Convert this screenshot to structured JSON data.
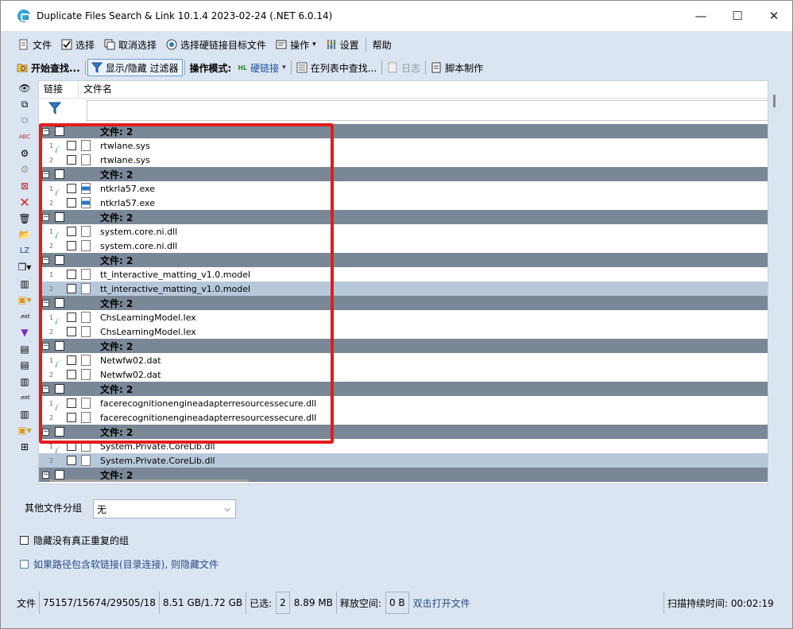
{
  "window": {
    "title": "Duplicate Files Search & Link 10.1.4 2023-02-24 (.NET 6.0.14)",
    "minimize": "—",
    "maximize": "☐",
    "close": "✕"
  },
  "menu": [
    {
      "label": "文件",
      "icon": "file-icon"
    },
    {
      "label": "选择",
      "icon": "select-icon"
    },
    {
      "label": "取消选择",
      "icon": "deselect-icon"
    },
    {
      "label": "选择硬链接目标文件",
      "icon": "hardlink-target-icon"
    },
    {
      "label": "操作",
      "icon": "operations-icon",
      "dropdown": "▾"
    },
    {
      "label": "设置",
      "icon": "settings-icon"
    },
    {
      "label": "帮助",
      "icon": ""
    }
  ],
  "toolbar": {
    "start_search": "开始查找...",
    "show_hide_filter": "显示/隐藏 过滤器",
    "mode_label": "操作模式:",
    "mode_value": "硬链接",
    "mode_badge": "HL",
    "find_in_list": "在列表中查找...",
    "log": "日志",
    "script": "脚本制作"
  },
  "grid": {
    "col_link": "链接",
    "col_filename": "文件名",
    "groups": [
      {
        "title": "文件: 2",
        "files": [
          {
            "index": "1",
            "name": "rtwlane.sys",
            "icon": "sys-file-icon",
            "selected": false
          },
          {
            "index": "2",
            "name": "rtwlane.sys",
            "icon": "sys-file-icon",
            "selected": false
          }
        ]
      },
      {
        "title": "文件: 2",
        "files": [
          {
            "index": "1",
            "name": "ntkrla57.exe",
            "icon": "exe-file-icon",
            "selected": false
          },
          {
            "index": "2",
            "name": "ntkrla57.exe",
            "icon": "exe-file-icon",
            "selected": false
          }
        ]
      },
      {
        "title": "文件: 2",
        "files": [
          {
            "index": "1",
            "name": "system.core.ni.dll",
            "icon": "dll-file-icon",
            "selected": false
          },
          {
            "index": "2",
            "name": "system.core.ni.dll",
            "icon": "dll-file-icon",
            "selected": false
          }
        ]
      },
      {
        "title": "文件: 2",
        "files": [
          {
            "index": "1",
            "name": "tt_interactive_matting_v1.0.model",
            "icon": "file-icon",
            "selected": false
          },
          {
            "index": "2",
            "name": "tt_interactive_matting_v1.0.model",
            "icon": "file-icon",
            "selected": true
          }
        ]
      },
      {
        "title": "文件: 2",
        "files": [
          {
            "index": "1",
            "name": "ChsLearningModel.lex",
            "icon": "file-icon",
            "selected": false
          },
          {
            "index": "2",
            "name": "ChsLearningModel.lex",
            "icon": "file-icon",
            "selected": false
          }
        ]
      },
      {
        "title": "文件: 2",
        "files": [
          {
            "index": "1",
            "name": "Netwfw02.dat",
            "icon": "file-icon",
            "selected": false
          },
          {
            "index": "2",
            "name": "Netwfw02.dat",
            "icon": "file-icon",
            "selected": false
          }
        ]
      },
      {
        "title": "文件: 2",
        "files": [
          {
            "index": "1",
            "name": "facerecognitionengineadapterresourcessecure.dll",
            "icon": "dll-file-icon",
            "selected": false
          },
          {
            "index": "2",
            "name": "facerecognitionengineadapterresourcessecure.dll",
            "icon": "dll-file-icon",
            "selected": false
          }
        ]
      },
      {
        "title": "文件: 2",
        "files": [
          {
            "index": "1",
            "name": "System.Private.CoreLib.dll",
            "icon": "dll-file-icon",
            "selected": false
          },
          {
            "index": "2",
            "name": "System.Private.CoreLib.dll",
            "icon": "dll-file-icon",
            "selected": true
          }
        ]
      },
      {
        "title": "文件: 2",
        "files": []
      }
    ]
  },
  "options": {
    "other_group_label": "其他文件分组",
    "other_group_value": "无",
    "hide_no_dupes": "隐藏没有真正重复的组",
    "hide_symlink": "如果路径包含软链接(目录连接), 则隐藏文件"
  },
  "status": {
    "files_label": "文件",
    "files_counts": "75157/15674/29505/18",
    "sizes": "8.51 GB/1.72 GB",
    "selected_label": "已选:",
    "selected_count": "2",
    "selected_size": "8.89 MB",
    "free_label": "释放空间:",
    "free_value": "0 B",
    "open_hint": "双击打开文件",
    "duration_label": "扫描持续时间: 00:02:19"
  },
  "colors": {
    "group_row": "#7a8796",
    "selected_row": "#b8c8db",
    "highlight": "#e21c1c",
    "window_bg": "#dbe5f1"
  }
}
